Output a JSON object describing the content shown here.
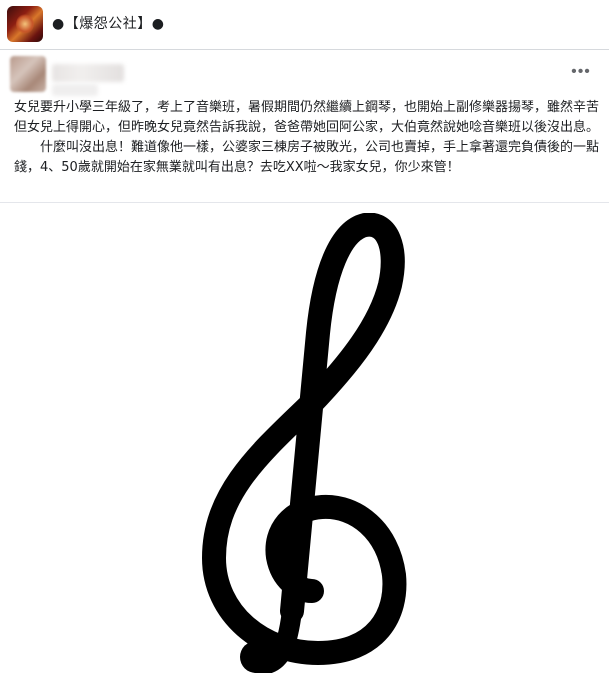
{
  "group": {
    "title": "●【爆怨公社】●",
    "avatar_icon": "group-avatar-flame"
  },
  "post": {
    "more_icon": "more-horizontal-icon",
    "more_label": "•••",
    "paragraphs": [
      "女兒要升小學三年級了，考上了音樂班，暑假期間仍然繼續上鋼琴，也開始上副修樂器揚琴，雖然辛苦但女兒上得開心，但昨晚女兒竟然告訴我說，爸爸帶她回阿公家，大伯竟然說她唸音樂班以後沒出息。",
      "什麼叫沒出息！難道像他一樣，公婆家三棟房子被敗光，公司也賣掉，手上拿著還完負債後的一點錢，4、50歲就開始在家無業就叫有出息？去吃XX啦～我家女兒，你少來管！"
    ],
    "image_icon": "treble-clef-icon",
    "colors": {
      "text": "#1c1e21",
      "muted": "#65676b",
      "divider": "#e4e6eb",
      "clef": "#000000"
    }
  }
}
